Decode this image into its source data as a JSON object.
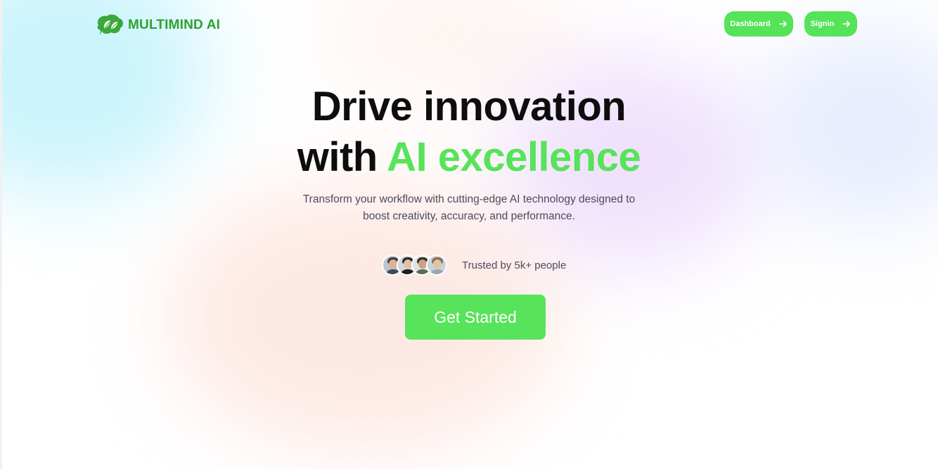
{
  "brand": {
    "name": "MULTIMIND AI",
    "logo_icon": "leaf-brain-icon",
    "color": "#2fa12e"
  },
  "nav": {
    "dashboard_label": "Dashboard",
    "signin_label": "Signin",
    "arrow_icon": "arrow-right-icon"
  },
  "hero": {
    "title_line1": "Drive innovation",
    "title_line2_prefix": "with ",
    "title_line2_accent": "AI excellence",
    "subtitle_line1": "Transform your workflow with cutting-edge AI technology designed to",
    "subtitle_line2": "boost creativity, accuracy, and performance.",
    "trust_text": "Trusted by 5k+ people",
    "cta_label": "Get Started"
  },
  "colors": {
    "accent": "#57e35a",
    "text_dark": "#0d0d0d",
    "text_muted": "#4b4b5a"
  }
}
